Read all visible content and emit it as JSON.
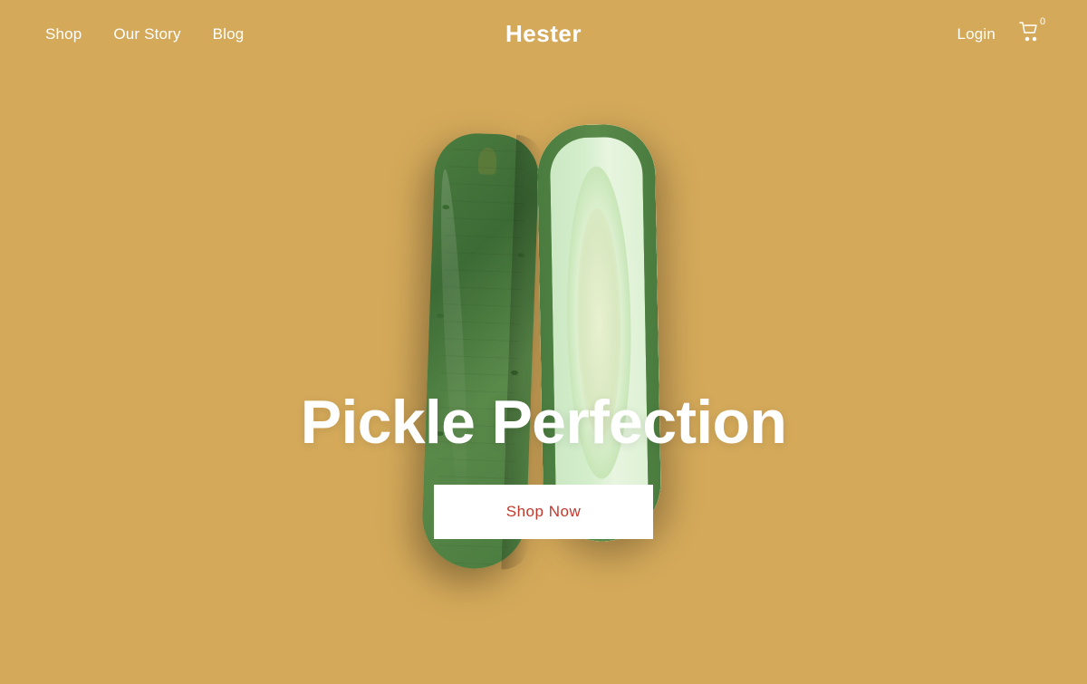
{
  "nav": {
    "left_links": [
      {
        "label": "Shop",
        "href": "#"
      },
      {
        "label": "Our Story",
        "href": "#"
      },
      {
        "label": "Blog",
        "href": "#"
      }
    ],
    "site_title": "Hester",
    "login_label": "Login",
    "cart_count": "0"
  },
  "hero": {
    "title": "Pickle Perfection",
    "cta_label": "Shop Now"
  },
  "colors": {
    "background": "#d4a95a",
    "text_primary": "#ffffff",
    "cta_text": "#c0392b",
    "cta_bg": "#ffffff"
  }
}
